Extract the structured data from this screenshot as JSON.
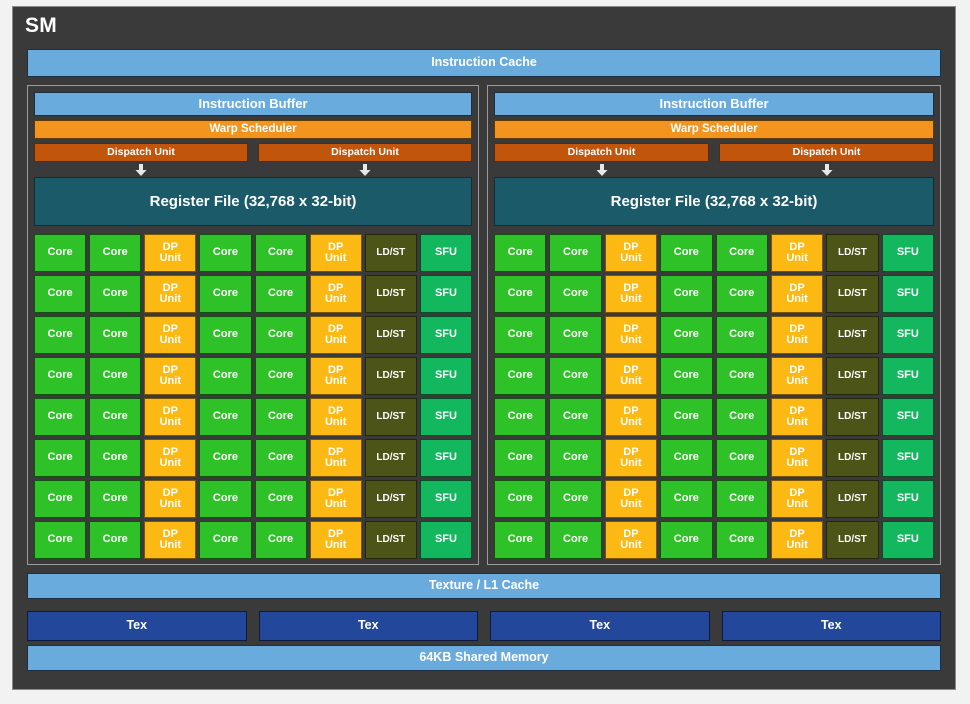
{
  "diagram": {
    "title": "SM",
    "instruction_cache": "Instruction Cache",
    "texture_l1_cache": "Texture / L1 Cache",
    "shared_memory": "64KB Shared Memory",
    "tex_label": "Tex",
    "tex_count": 4
  },
  "partition": {
    "instruction_buffer": "Instruction Buffer",
    "warp_scheduler": "Warp Scheduler",
    "dispatch_unit": "Dispatch Unit",
    "dispatch_unit_count": 2,
    "register_file": "Register File (32,768 x 32-bit)",
    "rows": 8,
    "columns": [
      {
        "type": "core",
        "label": "Core",
        "line1": "Core",
        "line2": ""
      },
      {
        "type": "core",
        "label": "Core",
        "line1": "Core",
        "line2": ""
      },
      {
        "type": "dp",
        "label": "DP Unit",
        "line1": "DP",
        "line2": "Unit"
      },
      {
        "type": "core",
        "label": "Core",
        "line1": "Core",
        "line2": ""
      },
      {
        "type": "core",
        "label": "Core",
        "line1": "Core",
        "line2": ""
      },
      {
        "type": "dp",
        "label": "DP Unit",
        "line1": "DP",
        "line2": "Unit"
      },
      {
        "type": "ldst",
        "label": "LD/ST",
        "line1": "LD/ST",
        "line2": ""
      },
      {
        "type": "sfu",
        "label": "SFU",
        "line1": "SFU",
        "line2": ""
      }
    ]
  },
  "partition_count": 2,
  "colors": {
    "chassis": "#3a3a3a",
    "page_background": "#f2f2f2",
    "cache_blue": "#6aabde",
    "warp_orange": "#f2941d",
    "dispatch_orange": "#c1550c",
    "register_teal": "#1b5a69",
    "core_green": "#2fc228",
    "dp_amber": "#fdb913",
    "ldst_olive": "#4c5417",
    "sfu_green": "#12b75e",
    "tex_blue": "#22479b",
    "text_white": "#ffffff"
  }
}
